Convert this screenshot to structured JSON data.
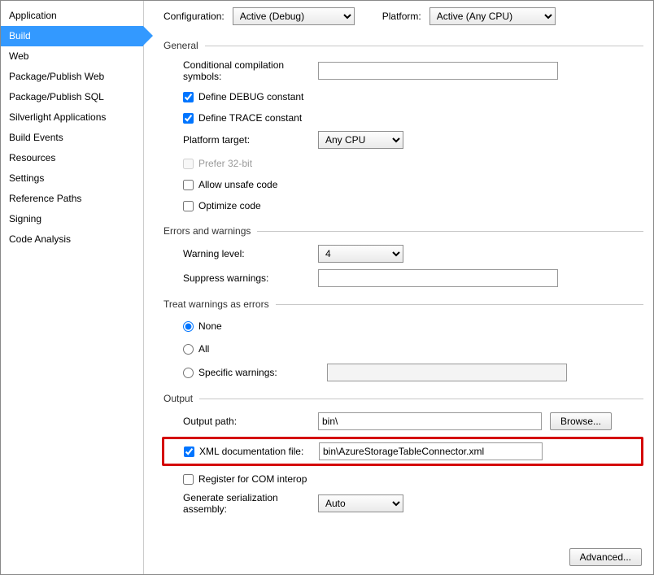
{
  "sidebar": {
    "items": [
      {
        "label": "Application"
      },
      {
        "label": "Build"
      },
      {
        "label": "Web"
      },
      {
        "label": "Package/Publish Web"
      },
      {
        "label": "Package/Publish SQL"
      },
      {
        "label": "Silverlight Applications"
      },
      {
        "label": "Build Events"
      },
      {
        "label": "Resources"
      },
      {
        "label": "Settings"
      },
      {
        "label": "Reference Paths"
      },
      {
        "label": "Signing"
      },
      {
        "label": "Code Analysis"
      }
    ]
  },
  "top": {
    "config_label": "Configuration:",
    "config_value": "Active (Debug)",
    "platform_label": "Platform:",
    "platform_value": "Active (Any CPU)"
  },
  "general": {
    "title": "General",
    "cond_label": "Conditional compilation symbols:",
    "cond_value": "",
    "define_debug": "Define DEBUG constant",
    "define_trace": "Define TRACE constant",
    "platform_target_label": "Platform target:",
    "platform_target_value": "Any CPU",
    "prefer32": "Prefer 32-bit",
    "allow_unsafe": "Allow unsafe code",
    "optimize": "Optimize code"
  },
  "errors": {
    "title": "Errors and warnings",
    "warning_level_label": "Warning level:",
    "warning_level_value": "4",
    "suppress_label": "Suppress warnings:",
    "suppress_value": ""
  },
  "treat": {
    "title": "Treat warnings as errors",
    "none": "None",
    "all": "All",
    "specific": "Specific warnings:",
    "specific_value": ""
  },
  "output": {
    "title": "Output",
    "path_label": "Output path:",
    "path_value": "bin\\",
    "browse": "Browse...",
    "xml_doc_label": "XML documentation file:",
    "xml_doc_value": "bin\\AzureStorageTableConnector.xml",
    "register_com": "Register for COM interop",
    "gen_ser_label": "Generate serialization assembly:",
    "gen_ser_value": "Auto"
  },
  "footer": {
    "advanced": "Advanced..."
  }
}
